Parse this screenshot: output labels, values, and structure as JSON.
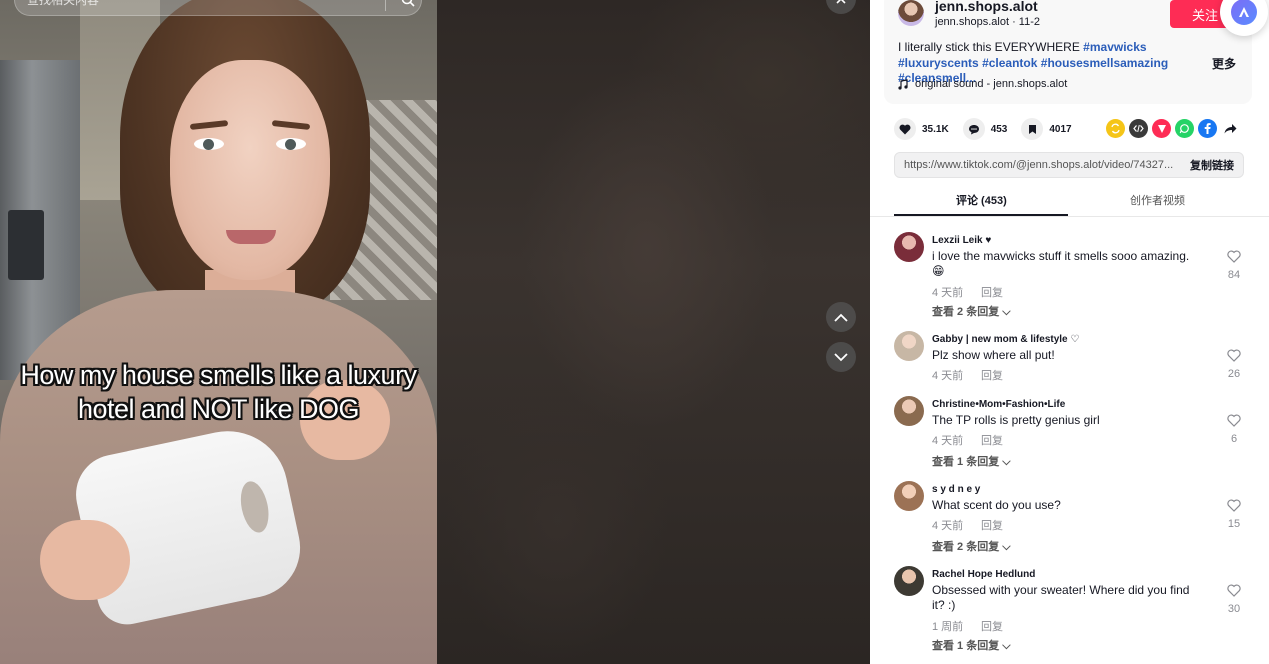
{
  "video": {
    "search_placeholder": "查找相关内容",
    "overlay_text": "How my house smells like a luxury hotel and NOT like DOG"
  },
  "author": {
    "username": "jenn.shops.alot",
    "handle": "jenn.shops.alot",
    "date": "11-2",
    "follow_label": "关注"
  },
  "caption": {
    "text": "I literally stick this EVERYWHERE",
    "tags": [
      "#mavwicks",
      "#luxuryscents",
      "#cleantok",
      "#housesmellsamazing",
      "#cleansmell..."
    ],
    "more_label": "更多"
  },
  "sound": {
    "label": "original sound - jenn.shops.alot"
  },
  "stats": {
    "likes": "35.1K",
    "comments": "453",
    "saves": "4017"
  },
  "share_link": {
    "url": "https://www.tiktok.com/@jenn.shops.alot/video/74327...",
    "copy_label": "复制链接"
  },
  "tabs": [
    {
      "label": "评论 (453)",
      "active": true
    },
    {
      "label": "创作者视频",
      "active": false
    }
  ],
  "comments": [
    {
      "name": "Lexzii Leik ♥",
      "text": "i love the mavwicks stuff it smells sooo amazing. 😁",
      "time": "4 天前",
      "reply": "回复",
      "more": "查看 2 条回复 ⌵",
      "likes": "84"
    },
    {
      "name": "Gabby | new mom & lifestyle ♡",
      "text": "Plz show where all put!",
      "time": "4 天前",
      "reply": "回复",
      "more": "",
      "likes": "26"
    },
    {
      "name": "Christine•Mom•Fashion•Life",
      "text": "The TP rolls is pretty genius girl",
      "time": "4 天前",
      "reply": "回复",
      "more": "查看 1 条回复 ⌵",
      "likes": "6"
    },
    {
      "name": "s y d n e y",
      "text": "What scent do you use?",
      "time": "4 天前",
      "reply": "回复",
      "more": "查看 2 条回复 ⌵",
      "likes": "15"
    },
    {
      "name": "Rachel Hope Hedlund",
      "text": "Obsessed with your sweater! Where did you find it? :)",
      "time": "1 周前",
      "reply": "回复",
      "more": "查看 1 条回复 ⌵",
      "likes": "30"
    }
  ],
  "colors": {
    "accent": "#fe2c55",
    "hashtag": "#2b5db9",
    "muted": "#8a8b91"
  }
}
